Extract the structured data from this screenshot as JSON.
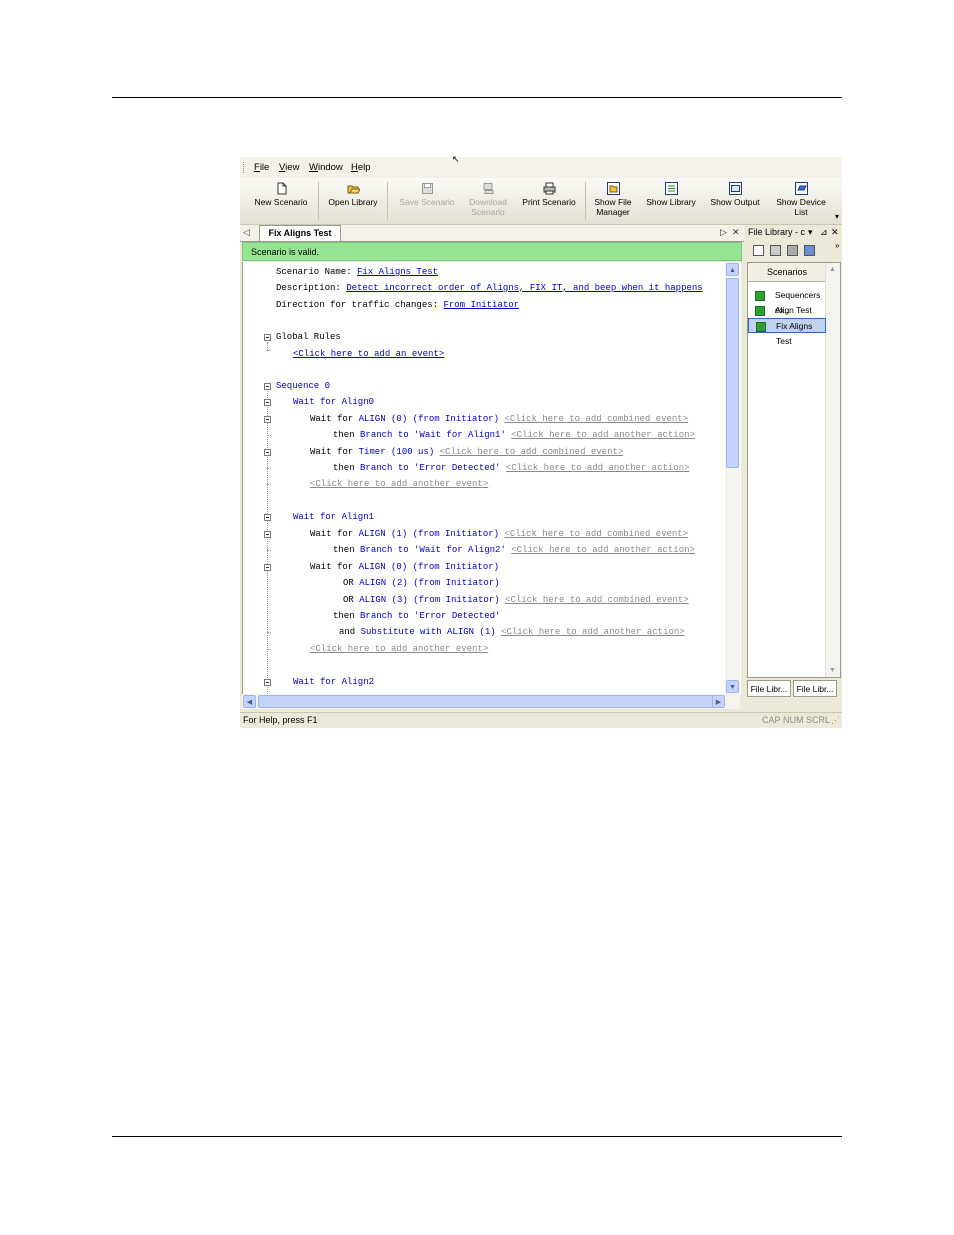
{
  "menu": {
    "items": [
      {
        "label": "File",
        "accel": "F"
      },
      {
        "label": "View",
        "accel": "V"
      },
      {
        "label": "Window",
        "accel": "W"
      },
      {
        "label": "Help",
        "accel": "H"
      }
    ]
  },
  "toolbar": {
    "new_scenario": "New Scenario",
    "open_library": "Open Library",
    "save_scenario": "Save Scenario",
    "download_scenario_1": "Download",
    "download_scenario_2": "Scenario",
    "print_scenario": "Print Scenario",
    "show_file_manager_1": "Show File",
    "show_file_manager_2": "Manager",
    "show_library": "Show Library",
    "show_output": "Show Output",
    "show_device_list_1": "Show Device",
    "show_device_list_2": "List"
  },
  "document": {
    "tab_title": "Fix Aligns Test",
    "status_banner": "Scenario is valid."
  },
  "scenario": {
    "name_label": "Scenario Name: ",
    "name_value": "Fix Aligns Test",
    "description_label": "Description: ",
    "description_value": "Detect incorrect order of Aligns, FIX IT, and beep when it happens",
    "direction_label": "Direction for traffic changes: ",
    "direction_value": "From Initiator",
    "global_rules": "Global Rules",
    "add_event": "<Click here to add an event>",
    "sequence": "Sequence 0",
    "wait_align0": "Wait for Align0",
    "wait_align1": "Wait for Align1",
    "wait_align2": "Wait for Align2",
    "wait_for": "Wait for ",
    "or": "OR ",
    "then": "then ",
    "and": "and ",
    "align0": "ALIGN (0)",
    "align1": "ALIGN (1)",
    "align2": "ALIGN (2)",
    "align3": "ALIGN (3)",
    "from_initiator": " (from Initiator)",
    "timer": "Timer (100 us)",
    "branch": "Branch",
    "to": " to ",
    "target_align1": "'Wait for Align1'",
    "target_align2": "'Wait for Align2'",
    "target_error": "'Error Detected'",
    "substitute": "Substitute with",
    "sub_align1": " ALIGN (1)",
    "add_combined": "<Click here to add combined event>",
    "add_action": "<Click here to add another action>",
    "add_another_event": "<Click here to add another event>"
  },
  "file_library": {
    "title": "File Library - c",
    "column_header": "Scenarios",
    "items": [
      "Sequencers ex...",
      "Align Test",
      "Fix Aligns Test"
    ],
    "selected_index": 2,
    "tabs": [
      "File Libr...",
      "File Libr..."
    ]
  },
  "statusbar": {
    "help": "For Help, press F1",
    "cap": "CAP",
    "num": "NUM",
    "scrl": "SCRL"
  }
}
